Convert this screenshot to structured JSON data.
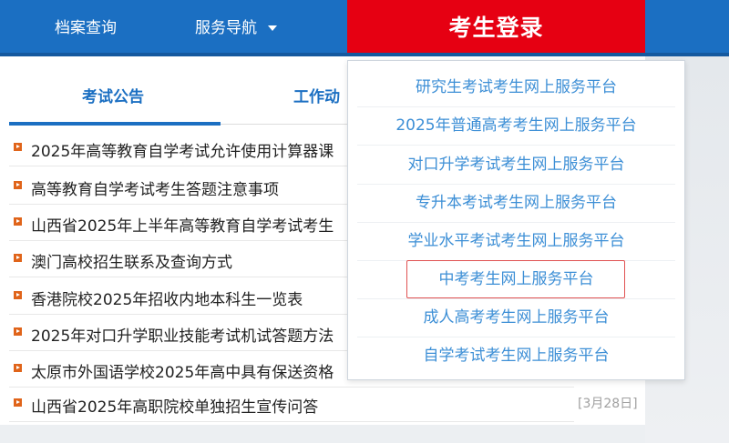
{
  "nav": {
    "archive_label": "档案查询",
    "service_label": "服务导航",
    "login_label": "考生登录"
  },
  "tabs": [
    {
      "label": "考试公告",
      "active": true
    },
    {
      "label": "工作动",
      "active": false
    }
  ],
  "news": [
    {
      "title": "2025年高等教育自学考试允许使用计算器课"
    },
    {
      "title": "高等教育自学考试考生答题注意事项"
    },
    {
      "title": "山西省2025年上半年高等教育自学考试考生"
    },
    {
      "title": "澳门高校招生联系及查询方式"
    },
    {
      "title": "香港院校2025年招收内地本科生一览表"
    },
    {
      "title": "2025年对口升学职业技能考试机试答题方法"
    },
    {
      "title": "太原市外国语学校2025年高中具有保送资格"
    },
    {
      "title": "山西省2025年高职院校单独招生宣传问答",
      "date": "[3月28日]"
    }
  ],
  "dropdown": {
    "items": [
      {
        "label": "研究生考试考生网上服务平台"
      },
      {
        "label": "2025年普通高考考生网上服务平台"
      },
      {
        "label": "对口升学考试考生网上服务平台"
      },
      {
        "label": "专升本考试考生网上服务平台"
      },
      {
        "label": "学业水平考试考生网上服务平台"
      },
      {
        "label": "中考考生网上服务平台",
        "highlighted": true
      },
      {
        "label": "成人高考考生网上服务平台"
      },
      {
        "label": "自学考试考生网上服务平台"
      }
    ]
  },
  "colors": {
    "nav_blue": "#1b6fc2",
    "login_red": "#e60012",
    "link_blue": "#3d8fd6",
    "bullet_orange": "#e0641a",
    "highlight_red": "#e05252"
  },
  "icons": {
    "nav_caret": "chevron-down-icon",
    "news_bullet": "bullet-arrow-icon"
  }
}
